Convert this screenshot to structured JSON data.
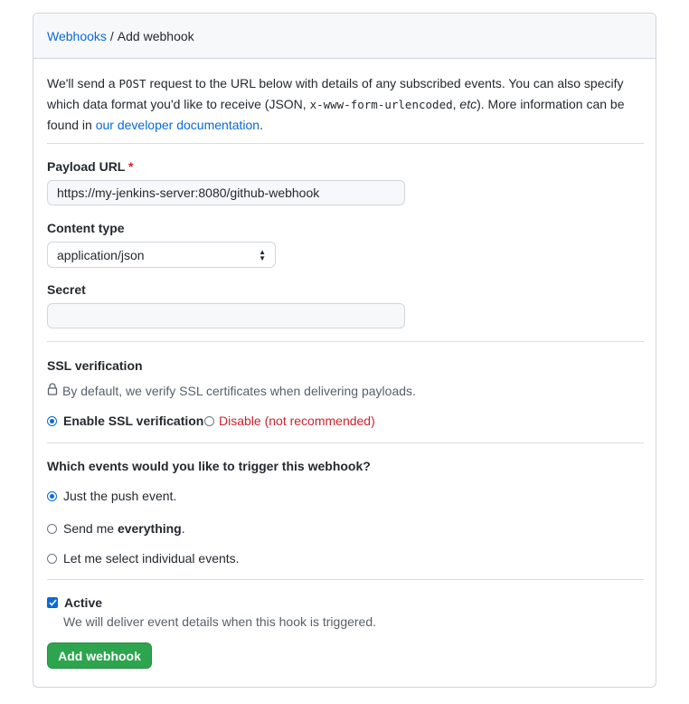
{
  "breadcrumb": {
    "parent": "Webhooks",
    "separator": "/",
    "current": "Add webhook"
  },
  "intro": {
    "part1": "We'll send a ",
    "code1": "POST",
    "part2": " request to the URL below with details of any subscribed events. You can also specify which data format you'd like to receive (JSON, ",
    "code2": "x-www-form-urlencoded",
    "part3": ", ",
    "etc": "etc",
    "part4": "). More information can be found in ",
    "link": "our developer documentation",
    "end": "."
  },
  "payload_url": {
    "label": "Payload URL",
    "required_mark": "*",
    "value": "https://my-jenkins-server:8080/github-webhook"
  },
  "content_type": {
    "label": "Content type",
    "selected": "application/json"
  },
  "secret": {
    "label": "Secret",
    "value": ""
  },
  "ssl": {
    "title": "SSL verification",
    "note": "By default, we verify SSL certificates when delivering payloads.",
    "enable_label": "Enable SSL verification",
    "disable_label": "Disable (not recommended)",
    "selected": "enable"
  },
  "events": {
    "question": "Which events would you like to trigger this webhook?",
    "option1": "Just the push event.",
    "option2_prefix": "Send me ",
    "option2_bold": "everything",
    "option2_suffix": ".",
    "option3": "Let me select individual events.",
    "selected": "push"
  },
  "active": {
    "label": "Active",
    "checked": true,
    "note": "We will deliver event details when this hook is triggered."
  },
  "submit": {
    "label": "Add webhook"
  },
  "colors": {
    "link": "#0969da",
    "primary_button": "#2da44e",
    "danger": "#cf222e"
  }
}
